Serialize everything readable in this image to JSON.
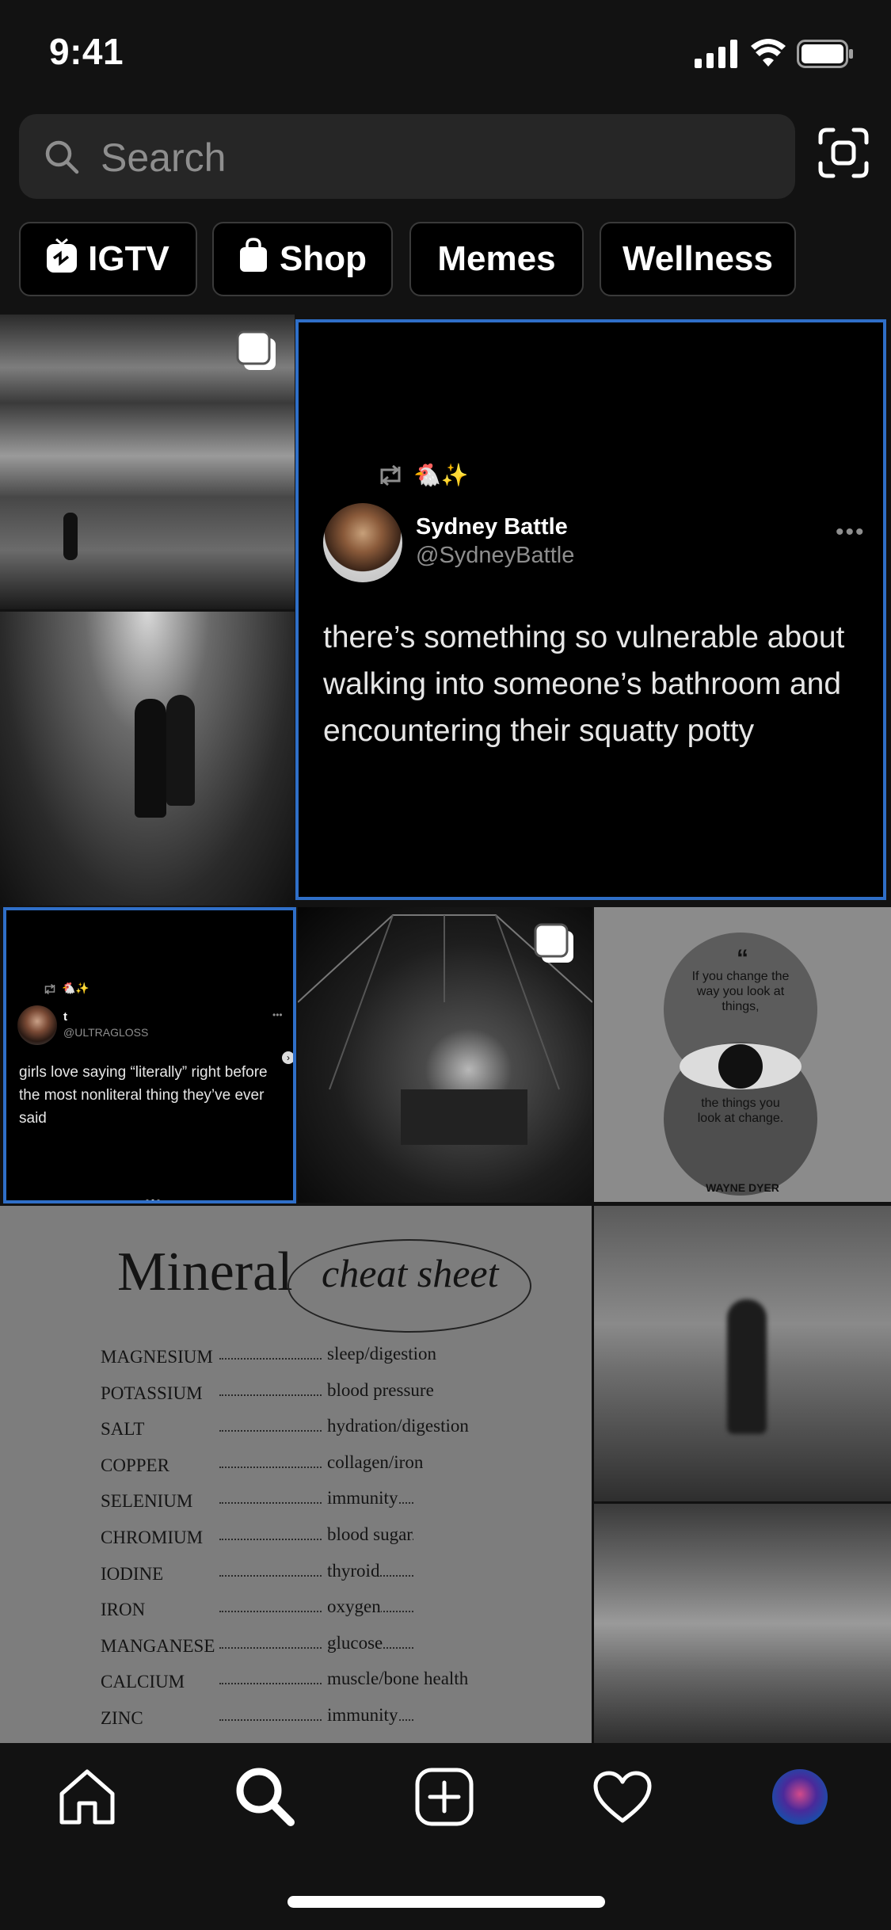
{
  "status_bar": {
    "time": "9:41"
  },
  "search": {
    "placeholder": "Search"
  },
  "chips": [
    {
      "label": "IGTV",
      "icon": "igtv-icon"
    },
    {
      "label": "Shop",
      "icon": "shopping-bag-icon"
    },
    {
      "label": "Memes"
    },
    {
      "label": "Wellness"
    }
  ],
  "tweet_large": {
    "emojis": "🐔✨",
    "name": "Sydney Battle",
    "handle": "@SydneyBattle",
    "body": "there’s something so vulnerable about walking into someone’s bathroom and encountering their squatty potty"
  },
  "tweet_small": {
    "emojis": "🐔✨",
    "name": "t",
    "handle": "@ULTRAGLOSS",
    "body": "girls love saying “literally” right before the most nonliteral thing they’ve ever said"
  },
  "quote_post": {
    "mark": "“",
    "top": "If you change the way you look at things,",
    "bottom": "the things you look at change.",
    "author": "WAYNE DYER"
  },
  "mineral_post": {
    "title_word": "Mineral",
    "title_script": "cheat sheet",
    "rows": [
      {
        "mineral": "MAGNESIUM",
        "use": "sleep/digestion"
      },
      {
        "mineral": "POTASSIUM",
        "use": "blood pressure"
      },
      {
        "mineral": "SALT",
        "use": "hydration/digestion"
      },
      {
        "mineral": "COPPER",
        "use": "collagen/iron"
      },
      {
        "mineral": "SELENIUM",
        "use": "immunity"
      },
      {
        "mineral": "CHROMIUM",
        "use": "blood sugar"
      },
      {
        "mineral": "IODINE",
        "use": "thyroid"
      },
      {
        "mineral": "IRON",
        "use": "oxygen"
      },
      {
        "mineral": "MANGANESE",
        "use": "glucose"
      },
      {
        "mineral": "CALCIUM",
        "use": "muscle/bone health"
      },
      {
        "mineral": "ZINC",
        "use": "immunity"
      }
    ]
  },
  "tab_bar": {
    "items": [
      "home-icon",
      "search-icon",
      "new-post-icon",
      "heart-icon",
      "profile-avatar"
    ]
  },
  "colors": {
    "background": "#121212",
    "selection": "#2f6fc8",
    "search_bg": "#262626"
  }
}
